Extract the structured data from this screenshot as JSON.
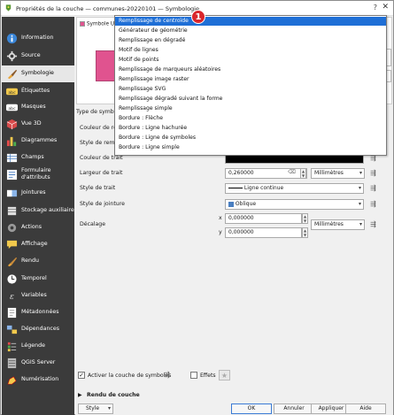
{
  "window": {
    "title": "Propriétés de la couche — communes-20220101 — Symbologie",
    "help": "?",
    "close": "✕"
  },
  "sidebar": {
    "items": [
      {
        "label": "Information",
        "icon": "info-icon"
      },
      {
        "label": "Source",
        "icon": "source-icon"
      },
      {
        "label": "Symbologie",
        "icon": "symbology-brush-icon"
      },
      {
        "label": "Étiquettes",
        "icon": "labels-abc-icon"
      },
      {
        "label": "Masques",
        "icon": "masks-abc-icon"
      },
      {
        "label": "Vue 3D",
        "icon": "cube-3d-icon"
      },
      {
        "label": "Diagrammes",
        "icon": "diagram-icon"
      },
      {
        "label": "Champs",
        "icon": "fields-table-icon"
      },
      {
        "label": "Formulaire\nd'attributs",
        "icon": "form-icon"
      },
      {
        "label": "Jointures",
        "icon": "joins-icon"
      },
      {
        "label": "Stockage auxiliaire",
        "icon": "auxiliary-storage-icon"
      },
      {
        "label": "Actions",
        "icon": "actions-gear-icon"
      },
      {
        "label": "Affichage",
        "icon": "display-speech-icon"
      },
      {
        "label": "Rendu",
        "icon": "rendering-brush-icon"
      },
      {
        "label": "Temporel",
        "icon": "temporal-clock-icon"
      },
      {
        "label": "Variables",
        "icon": "variables-icon"
      },
      {
        "label": "Métadonnées",
        "icon": "metadata-icon"
      },
      {
        "label": "Dépendances",
        "icon": "dependencies-icon"
      },
      {
        "label": "Légende",
        "icon": "legend-icon"
      },
      {
        "label": "QGIS Server",
        "icon": "qgis-server-icon"
      },
      {
        "label": "Numérisation",
        "icon": "digitizing-icon"
      }
    ],
    "active_index": 2
  },
  "symbol_tree": {
    "row_label": "Symbole Un"
  },
  "dropdown": {
    "items": [
      "Remplissage de centroïde",
      "Générateur de géométrie",
      "Remplissage en dégradé",
      "Motif de lignes",
      "Motif de points",
      "Remplissage de marqueurs aléatoires",
      "Remplissage image raster",
      "Remplissage SVG",
      "Remplissage dégradé suivant la forme",
      "Remplissage simple",
      "Bordure : Flèche",
      "Bordure : Ligne hachurée",
      "Bordure : Ligne de symboles",
      "Bordure : Ligne simple"
    ],
    "selected_index": 0
  },
  "badge": {
    "text": "1"
  },
  "form": {
    "type_label": "Type de symbole",
    "fill_color_label": "Couleur de rem",
    "fill_style_label": "Style de rempl",
    "stroke_color_label": "Couleur de trait",
    "stroke_width_label": "Largeur de trait",
    "stroke_width_value": "0,260000",
    "stroke_width_unit": "Millimètres",
    "stroke_style_label": "Style de trait",
    "stroke_style_value": "Ligne continue",
    "join_style_label": "Style de jointure",
    "join_style_value": "Oblique",
    "offset_label": "Décalage",
    "offset_x_label": "x",
    "offset_x_value": "0,000000",
    "offset_y_label": "y",
    "offset_y_value": "0,000000",
    "offset_unit": "Millimètres"
  },
  "bottom": {
    "enable_layer_label": "Activer la couche de symboles",
    "effects_label": "Effets",
    "layer_rendering_label": "Rendu de couche"
  },
  "buttons": {
    "style": "Style",
    "ok": "OK",
    "cancel": "Annuler",
    "apply": "Appliquer",
    "help": "Aide"
  },
  "colors": {
    "fill_swatch": "#e0538f",
    "selection": "#1f6fd6",
    "sidebar_bg": "#3b3b3b",
    "badge": "#d9262c"
  }
}
